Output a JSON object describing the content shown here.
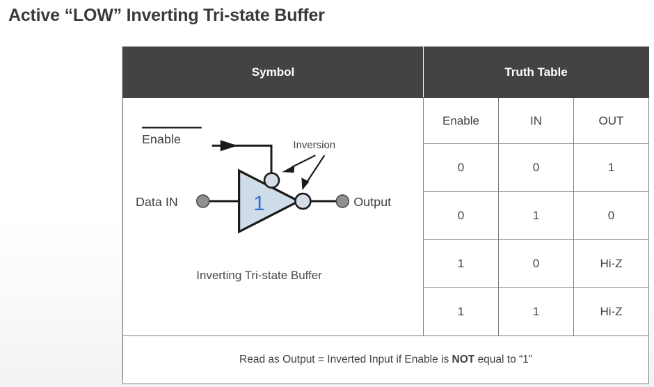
{
  "page": {
    "title": "Active “LOW” Inverting Tri-state Buffer"
  },
  "colors": {
    "header_bg": "#434343",
    "header_text": "#ffffff",
    "grid_line": "#808080",
    "outer_border": "#cfcfcf",
    "gate_fill": "#cfdcea",
    "gate_stroke": "#1a1a1a",
    "gate_number": "#2b6fd4",
    "terminal_dot": "#909090",
    "text": "#3f3f3f"
  },
  "figure": {
    "headers": {
      "symbol": "Symbol",
      "truth_table": "Truth Table"
    },
    "symbol": {
      "enable_label": "Enable",
      "enable_active_low": true,
      "data_in_label": "Data IN",
      "output_label": "Output",
      "inversion_label": "Inversion",
      "gate_number": "1",
      "caption": "Inverting Tri-state Buffer"
    },
    "truth_table": {
      "columns": [
        "Enable",
        "IN",
        "OUT"
      ],
      "rows": [
        [
          "0",
          "0",
          "1"
        ],
        [
          "0",
          "1",
          "0"
        ],
        [
          "1",
          "0",
          "Hi-Z"
        ],
        [
          "1",
          "1",
          "Hi-Z"
        ]
      ]
    },
    "footer": {
      "prefix": "Read as Output = Inverted Input if Enable is ",
      "emphasis": "NOT",
      "suffix": " equal to “1”"
    }
  }
}
